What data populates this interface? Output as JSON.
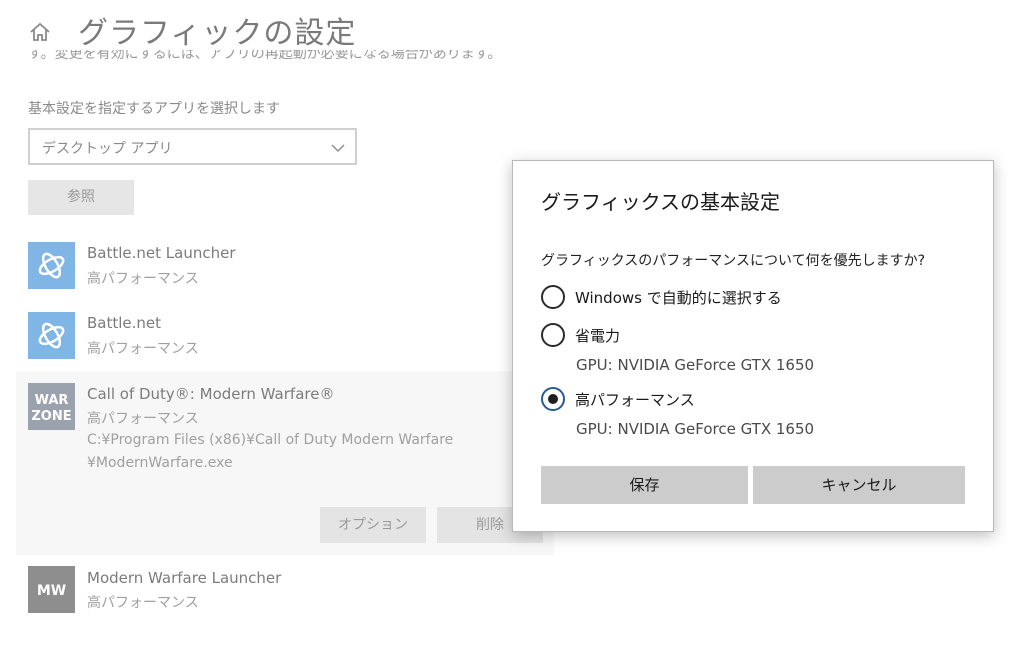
{
  "header": {
    "title": "グラフィックの設定",
    "cut_description": "す。変更を有効にするには、アプリの再起動が必要になる場合があります。"
  },
  "app_picker": {
    "label": "基本設定を指定するアプリを選択します",
    "selected": "デスクトップ アプリ",
    "browse_label": "参照"
  },
  "apps": [
    {
      "name": "Battle.net Launcher",
      "preference": "高パフォーマンス"
    },
    {
      "name": "Battle.net",
      "preference": "高パフォーマンス"
    },
    {
      "name": "Call of Duty®: Modern Warfare®",
      "preference": "高パフォーマンス",
      "path_line1": "C:¥Program Files (x86)¥Call of Duty Modern Warfare",
      "path_line2": "¥ModernWarfare.exe",
      "options_label": "オプション",
      "delete_label": "削除",
      "icon_text_1": "WAR",
      "icon_text_2": "ZONE"
    },
    {
      "name": "Modern Warfare Launcher",
      "preference": "高パフォーマンス",
      "icon_text": "MW"
    }
  ],
  "dialog": {
    "title": "グラフィックスの基本設定",
    "question": "グラフィックスのパフォーマンスについて何を優先しますか?",
    "options": [
      {
        "label": "Windows で自動的に選択する",
        "checked": false
      },
      {
        "label": "省電力",
        "gpu": "GPU: NVIDIA GeForce GTX 1650",
        "checked": false
      },
      {
        "label": "高パフォーマンス",
        "gpu": "GPU: NVIDIA GeForce GTX 1650",
        "checked": true
      }
    ],
    "save_label": "保存",
    "cancel_label": "キャンセル"
  },
  "colors": {
    "battle_icon_bg": "#7fb6e6",
    "warzone_icon_bg": "#9aa3ad",
    "mw_icon_bg": "#8e8e8e",
    "radio_checked_border": "#2b5a8f"
  },
  "icons": {
    "home": "home-icon",
    "chevron": "chevron-down-icon"
  }
}
